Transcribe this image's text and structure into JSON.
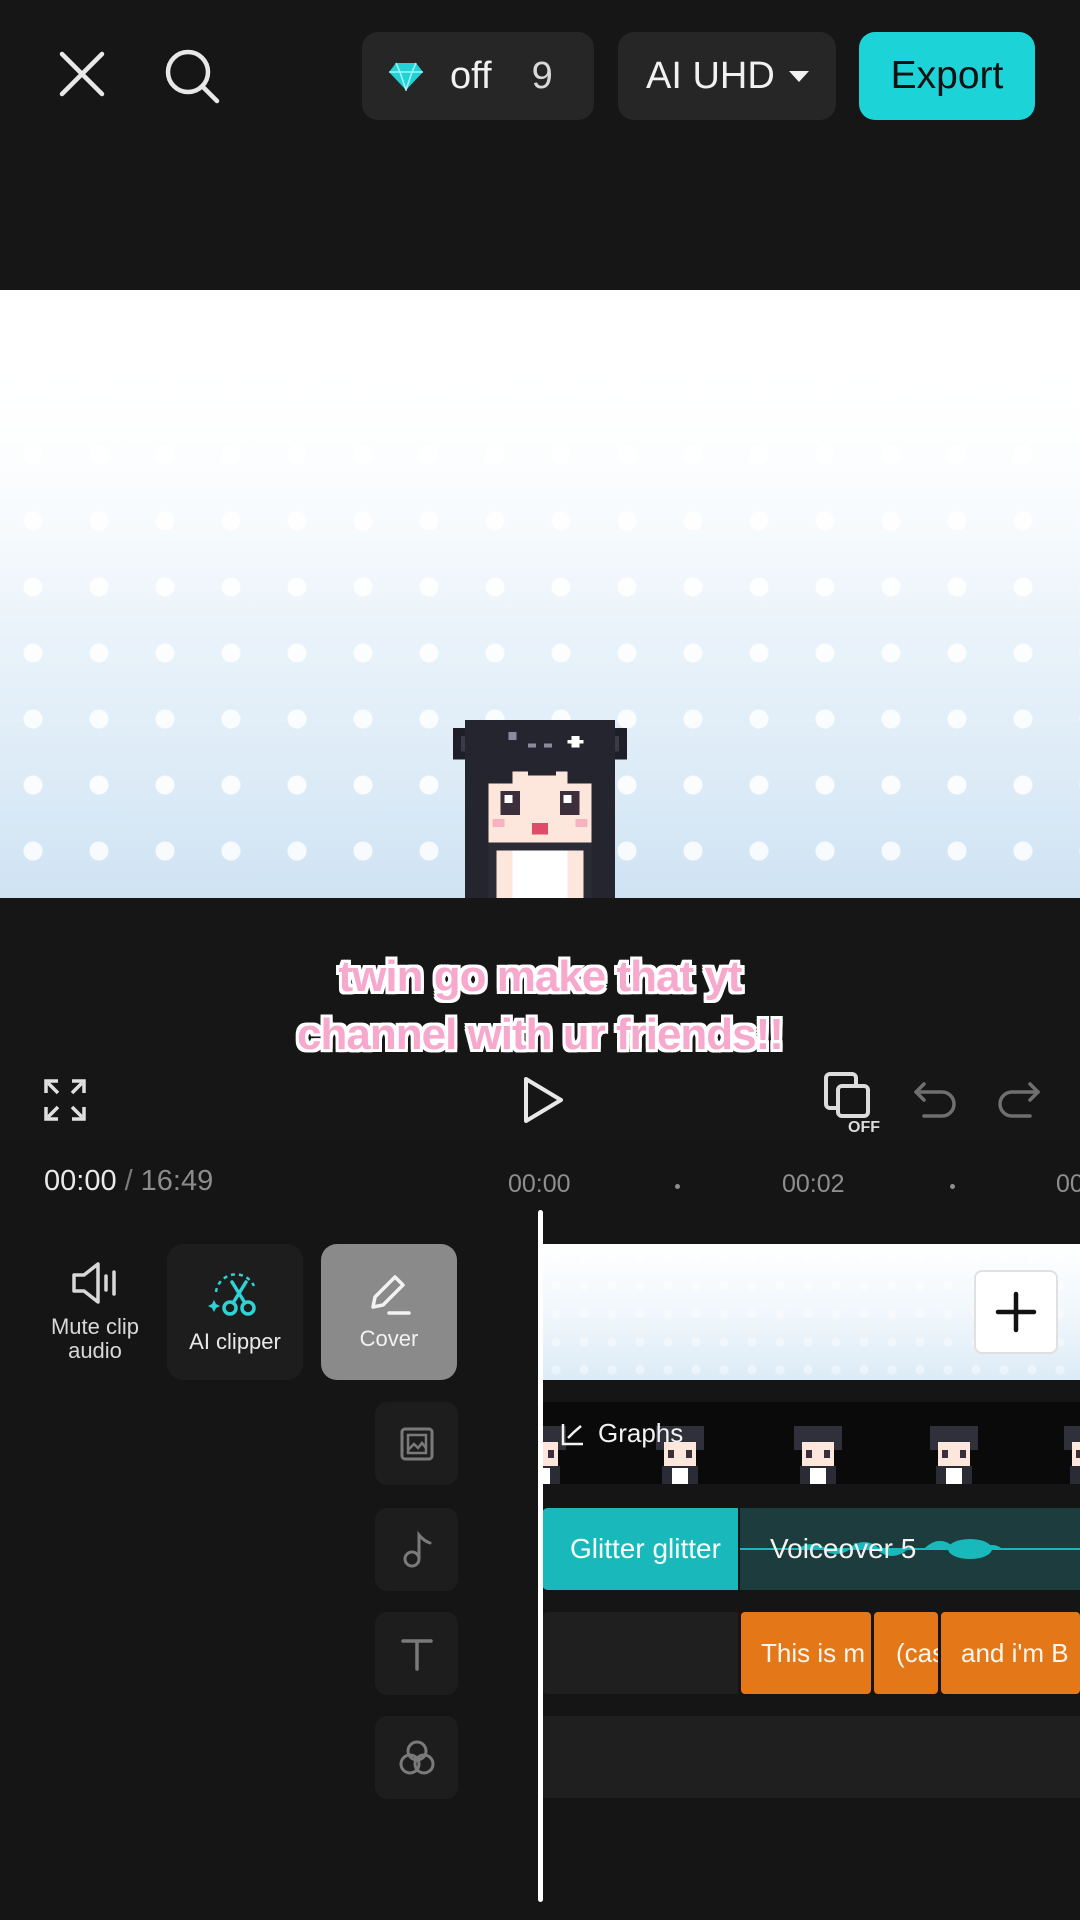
{
  "topbar": {
    "credits_label": "off",
    "credits_count": "9",
    "quality_label": "AI UHD",
    "export_label": "Export"
  },
  "preview": {
    "caption_line1": "twin go make that yt",
    "caption_line2": "channel with ur friends!!"
  },
  "controls": {
    "keyframe_off_label": "OFF"
  },
  "time": {
    "current": "00:00",
    "separator": "/",
    "total": "16:49",
    "ruler": [
      "00:00",
      "00:02",
      "00"
    ]
  },
  "tools": {
    "mute_label": "Mute clip audio",
    "ai_clipper_label": "AI clipper",
    "cover_label": "Cover"
  },
  "tracks": {
    "sticker_title": "Graphs",
    "audio": [
      "Glitter glitter",
      "Voiceover 5"
    ],
    "text": [
      "This is m",
      "(cas",
      "and i'm B"
    ]
  },
  "colors": {
    "accent": "#1cd3d8",
    "caption_pink": "#f7a8cd",
    "text_clip": "#e47717",
    "audio_clip": "#19b8bb"
  }
}
